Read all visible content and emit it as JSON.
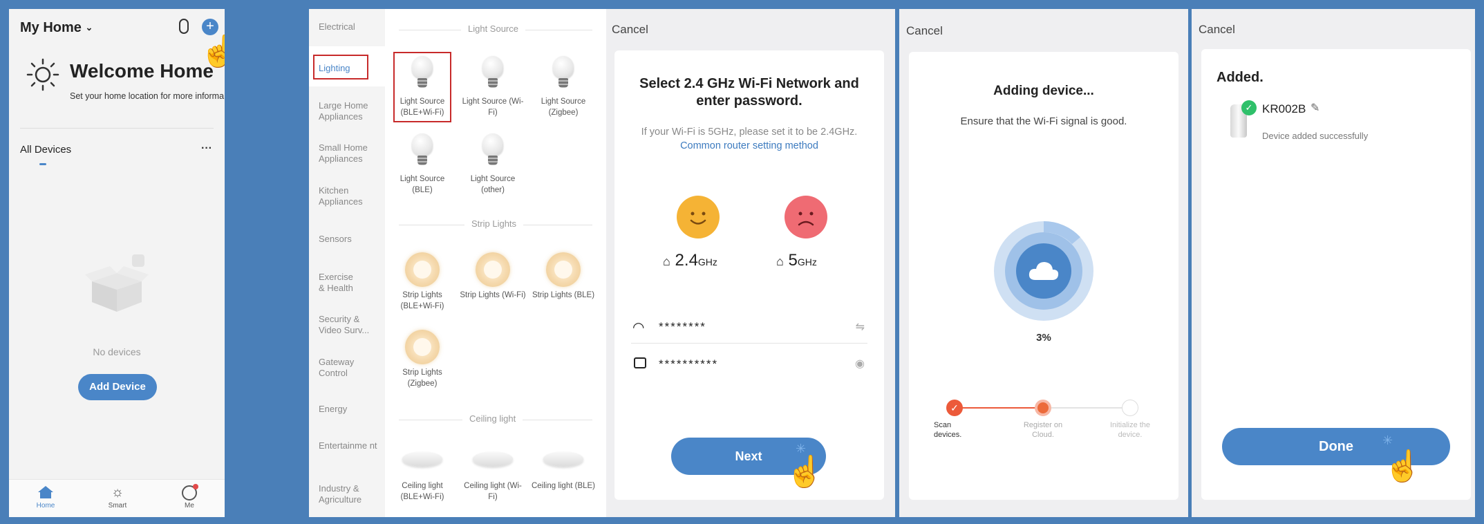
{
  "home": {
    "title": "My Home",
    "welcome": "Welcome Home",
    "location_prompt": "Set your home location for more informa...",
    "all_devices": "All Devices",
    "more": "···",
    "no_devices": "No devices",
    "add_device": "Add Device",
    "tabs": [
      {
        "label": "Home",
        "active": true
      },
      {
        "label": "Smart",
        "active": false
      },
      {
        "label": "Me",
        "active": false
      }
    ]
  },
  "catalog": {
    "categories": [
      "Electrical",
      "Lighting",
      "Large Home Appliances",
      "Small Home Appliances",
      "Kitchen Appliances",
      "Sensors",
      "Exercise & Health",
      "Security & Video Surv...",
      "Gateway Control",
      "Energy",
      "Entertainme nt",
      "Industry & Agriculture"
    ],
    "selected_category": "Lighting",
    "sections": [
      {
        "title": "Light Source",
        "items": [
          "Light Source (BLE+Wi-Fi)",
          "Light Source (Wi-Fi)",
          "Light Source (Zigbee)",
          "Light Source (BLE)",
          "Light Source (other)"
        ]
      },
      {
        "title": "Strip Lights",
        "items": [
          "Strip Lights (BLE+Wi-Fi)",
          "Strip Lights (Wi-Fi)",
          "Strip Lights (BLE)",
          "Strip Lights (Zigbee)"
        ]
      },
      {
        "title": "Ceiling light",
        "items": [
          "Ceiling light (BLE+Wi-Fi)",
          "Ceiling light (Wi-Fi)",
          "Ceiling light (BLE)"
        ]
      }
    ]
  },
  "wifi": {
    "cancel": "Cancel",
    "title": "Select 2.4 GHz Wi-Fi Network and enter password.",
    "hint": "If your Wi-Fi is 5GHz, please set it to be 2.4GHz.",
    "hint_link": "Common router setting method",
    "band_good": "2.4",
    "band_bad": "5",
    "ghz": "GHz",
    "ssid": "********",
    "password": "**********",
    "next": "Next",
    "colors": {
      "good": "#f5b335",
      "bad": "#ef6b73"
    }
  },
  "adding": {
    "cancel": "Cancel",
    "title": "Adding device...",
    "subtitle": "Ensure that the Wi-Fi signal is good.",
    "progress_text": "3%",
    "progress_value": 0.03,
    "steps": [
      {
        "label": "Scan devices.",
        "state": "done"
      },
      {
        "label": "Register on Cloud.",
        "state": "active"
      },
      {
        "label": "Initialize the device.",
        "state": "pending"
      }
    ]
  },
  "added": {
    "cancel": "Cancel",
    "title": "Added.",
    "device_name": "KR002B",
    "status": "Device added successfully",
    "done": "Done"
  }
}
